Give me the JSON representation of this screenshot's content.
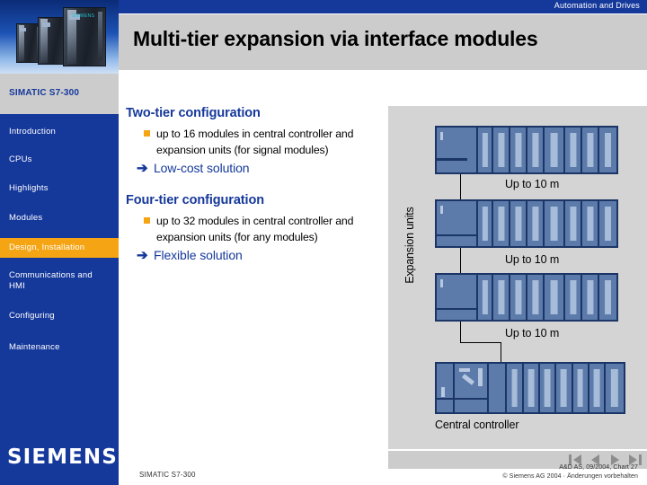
{
  "header": {
    "banner_text": "Automation and Drives",
    "title": "Multi-tier expansion via interface modules",
    "product_label": "SIMATIC S7-300"
  },
  "sidebar": {
    "items": [
      {
        "label": "Introduction",
        "active": false
      },
      {
        "label": "CPUs",
        "active": false
      },
      {
        "label": "Highlights",
        "active": false
      },
      {
        "label": "Modules",
        "active": false
      },
      {
        "label": "Design, Installation",
        "active": true
      },
      {
        "label": "Communications and HMI",
        "active": false
      },
      {
        "label": "Configuring",
        "active": false
      },
      {
        "label": "Maintenance",
        "active": false
      }
    ],
    "logo": "SIEMENS"
  },
  "content": {
    "sections": [
      {
        "heading": "Two-tier configuration",
        "bullet": "up to 16 modules in central controller and expansion units (for signal modules)",
        "arrow_glyph": "➔",
        "conclusion": "Low-cost solution"
      },
      {
        "heading": "Four-tier configuration",
        "bullet": "up to 32 modules in central controller and expansion units (for any modules)",
        "arrow_glyph": "➔",
        "conclusion": "Flexible solution"
      }
    ]
  },
  "diagram": {
    "vertical_label": "Expansion units",
    "distance_labels": [
      "Up to 10 m",
      "Up to 10 m",
      "Up to 10 m"
    ],
    "central_controller_label": "Central controller",
    "colors": {
      "panel_bg": "#d4d4d4",
      "rack_fill": "#5c7bab",
      "rack_border": "#1b3566",
      "module_face": "#a7bcd8"
    },
    "racks": [
      {
        "name": "expansion-unit-1",
        "modules": 8
      },
      {
        "name": "expansion-unit-2",
        "modules": 8
      },
      {
        "name": "expansion-unit-3",
        "modules": 8
      },
      {
        "name": "central-controller",
        "modules": 8
      }
    ]
  },
  "footer": {
    "left_text": "SIMATIC S7-300",
    "ref_line": "A&D AS, 09/2004, Chart 27",
    "copyright_line": "© Siemens AG 2004 ·  Änderungen vorbehalten",
    "nav_buttons": [
      "first",
      "previous",
      "next",
      "last"
    ]
  },
  "theme": {
    "brand_blue": "#15389b",
    "accent_orange": "#f5a413",
    "gray_panel": "#cccccc"
  }
}
